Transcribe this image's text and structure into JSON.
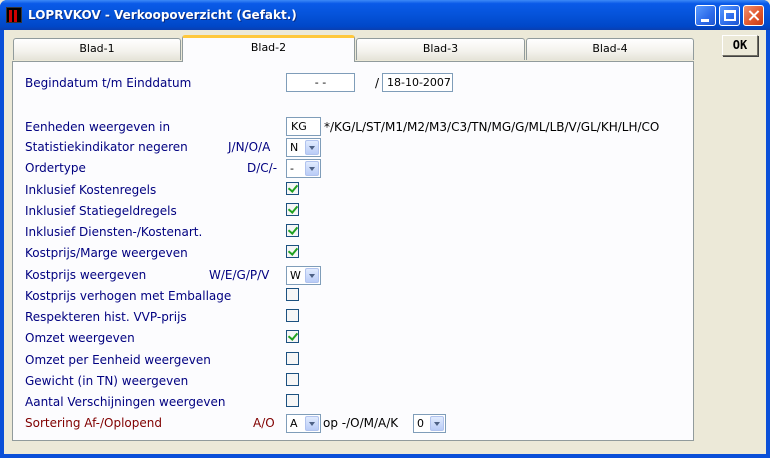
{
  "window": {
    "title": "LOPRVKOV - Verkoopoverzicht (Gefakt.)",
    "ok_label": "OK"
  },
  "tabs": [
    {
      "label": "Blad-1",
      "active": false
    },
    {
      "label": "Blad-2",
      "active": true
    },
    {
      "label": "Blad-3",
      "active": false
    },
    {
      "label": "Blad-4",
      "active": false
    }
  ],
  "form": {
    "date_range": {
      "label": "Begindatum t/m Einddatum",
      "start_value": "- -",
      "separator": "/",
      "end_value": "18-10-2007"
    },
    "units": {
      "label": "Eenheden weergeven in",
      "value": "KG",
      "options_hint": "*/KG/L/ST/M1/M2/M3/C3/TN/MG/G/ML/LB/V/GL/KH/LH/CO"
    },
    "stat_indicator": {
      "label": "Statistiekindikator negeren",
      "hint": "J/N/O/A",
      "value": "N"
    },
    "order_type": {
      "label": "Ordertype",
      "hint": "D/C/-",
      "value": "-"
    },
    "cost_rules": {
      "label": "Inklusief Kostenregels",
      "checked": true
    },
    "deposit_rules": {
      "label": "Inklusief Statiegeldregels",
      "checked": true
    },
    "services": {
      "label": "Inklusief Diensten-/Kostenart.",
      "checked": true
    },
    "cost_margin": {
      "label": "Kostprijs/Marge weergeven",
      "checked": true
    },
    "cost_price_show": {
      "label": "Kostprijs weergeven",
      "hint": "W/E/G/P/V",
      "value": "W"
    },
    "cost_packaging": {
      "label": "Kostprijs verhogen met Emballage",
      "checked": false
    },
    "respect_vvp": {
      "label": "Respekteren hist. VVP-prijs",
      "checked": false
    },
    "revenue": {
      "label": "Omzet weergeven",
      "checked": true
    },
    "revenue_unit": {
      "label": "Omzet per Eenheid weergeven",
      "checked": false
    },
    "weight": {
      "label": "Gewicht (in TN) weergeven",
      "checked": false
    },
    "occurrences": {
      "label": "Aantal Verschijningen weergeven",
      "checked": false
    },
    "sorting": {
      "label": "Sortering Af-/Oplopend",
      "hint": "A/O",
      "value": "A",
      "on_label": "op -/O/M/A/K",
      "on_value": "0"
    }
  }
}
